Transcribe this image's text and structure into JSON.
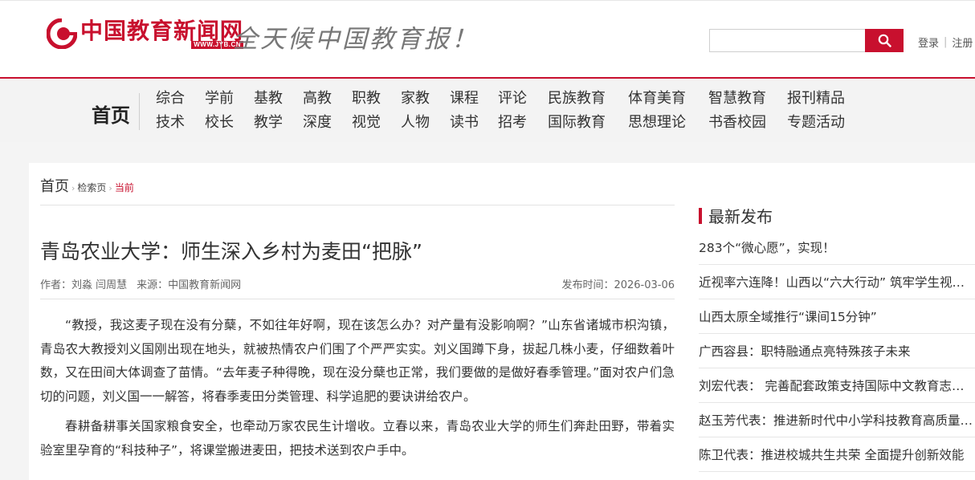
{
  "header": {
    "logo_text": "中国教育新闻网",
    "logo_url": "WWW.JYB.CN",
    "slogan": "全天候中国教育报！",
    "search_placeholder": "",
    "login": "登录",
    "separator": "|",
    "register": "注册"
  },
  "colors": {
    "brand_red": "#c8102e",
    "nav_bg": "#f3f3f3",
    "page_bg": "#f4f4f4"
  },
  "nav": {
    "home": "首页",
    "row1": [
      "综合",
      "学前",
      "基教",
      "高教",
      "职教",
      "家教",
      "课程",
      "评论",
      "民族教育",
      "体育美育",
      "智慧教育",
      "报刊精品"
    ],
    "row2": [
      "技术",
      "校长",
      "教学",
      "深度",
      "视觉",
      "人物",
      "读书",
      "招考",
      "国际教育",
      "思想理论",
      "书香校园",
      "专题活动"
    ]
  },
  "breadcrumb": {
    "home": "首页",
    "search": "检索页",
    "current": "当前"
  },
  "article": {
    "title": "青岛农业大学：师生深入乡村为麦田“把脉”",
    "authors": "作者：刘淼 闫周慧",
    "source": "来源：中国教育新闻网",
    "published": "发布时间：2026-03-06",
    "paragraphs": [
      "“教授，我这麦子现在没有分蘖，不如往年好啊，现在该怎么办？对产量有没影响啊？”山东省诸城市枳沟镇，青岛农大教授刘义国刚出现在地头，就被热情农户们围了个严严实实。刘义国蹲下身，拔起几株小麦，仔细数着叶数，又在田间大体调查了苗情。“去年麦子种得晚，现在没分蘖也正常，我们要做的是做好春季管理。”面对农户们急切的问题，刘义国一一解答，将春季麦田分类管理、科学追肥的要诀讲给农户。",
      "春耕备耕事关国家粮食安全，也牵动万家农民生计增收。立春以来，青岛农业大学的师生们奔赴田野，带着实验室里孕育的“科技种子”，将课堂搬进麦田，把技术送到农户手中。"
    ]
  },
  "sidebar": {
    "title": "最新发布",
    "items": [
      "283个“微心愿”，实现！",
      "近视率六连降！山西以“六大行动” 筑牢学生视力健康防线",
      "山西太原全域推行“课间15分钟”",
      "广西容县：职特融通点亮特殊孩子未来",
      "刘宏代表： 完善配套政策支持国际中文教育志愿者",
      "赵玉芳代表：推进新时代中小学科技教育高质量发展",
      "陈卫代表：推进校城共生共荣 全面提升创新效能"
    ]
  }
}
